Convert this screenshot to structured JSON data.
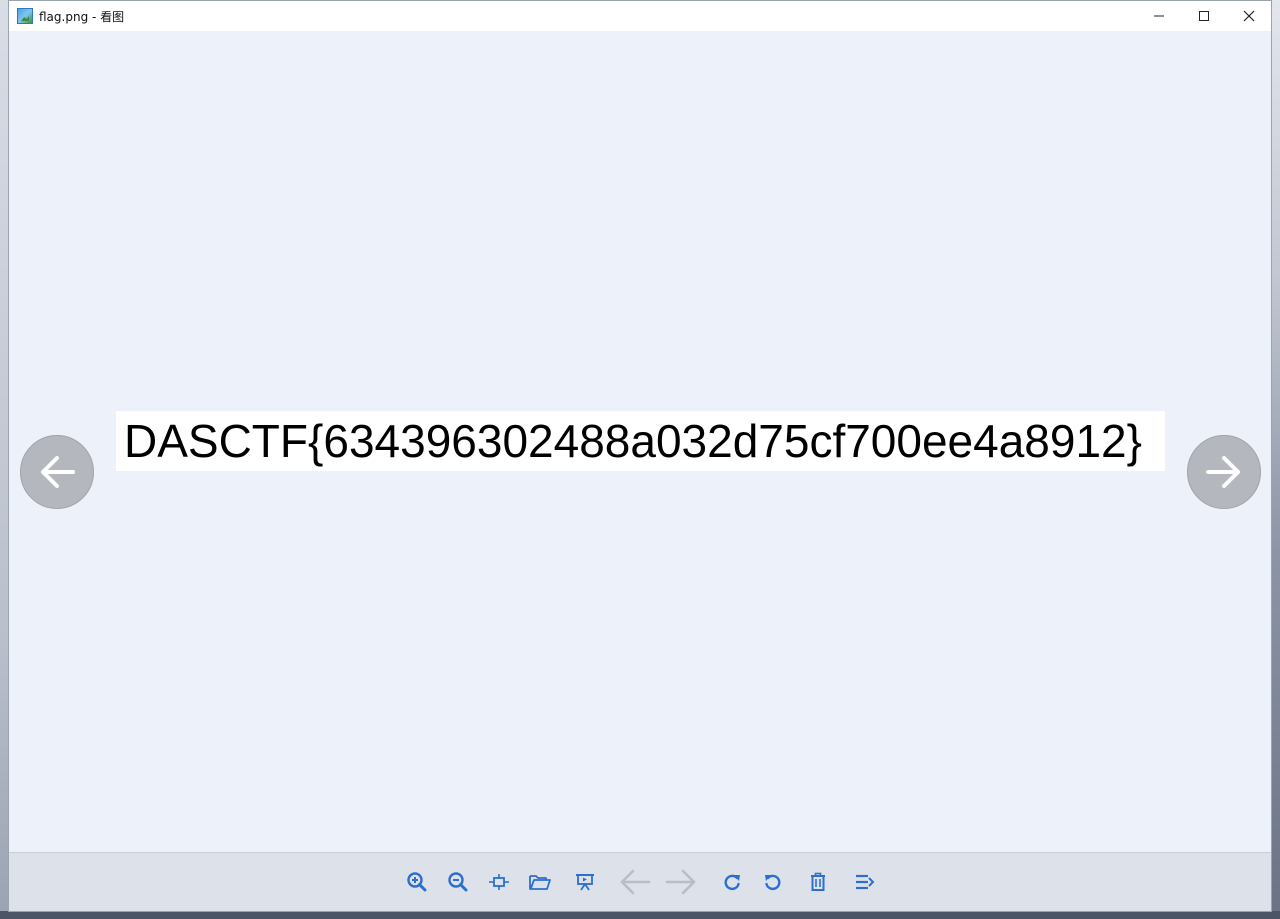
{
  "window": {
    "title": "flag.png - 看图"
  },
  "controls": {
    "minimize_icon": "minimize-icon",
    "maximize_icon": "maximize-icon",
    "close_icon": "close-icon"
  },
  "viewer": {
    "flag_text": "DASCTF{634396302488a032d75cf700ee4a8912}"
  },
  "toolbar": {
    "buttons": [
      "zoom-in-icon",
      "zoom-out-icon",
      "fit-to-window-icon",
      "open-folder-icon",
      "slideshow-icon",
      "previous-icon",
      "next-icon",
      "rotate-clockwise-icon",
      "rotate-counterclockwise-icon",
      "delete-icon",
      "more-menu-icon"
    ]
  },
  "colors": {
    "accent": "#2d6fd0",
    "disabled": "#b9bdc4",
    "background": "#edf1fa"
  }
}
